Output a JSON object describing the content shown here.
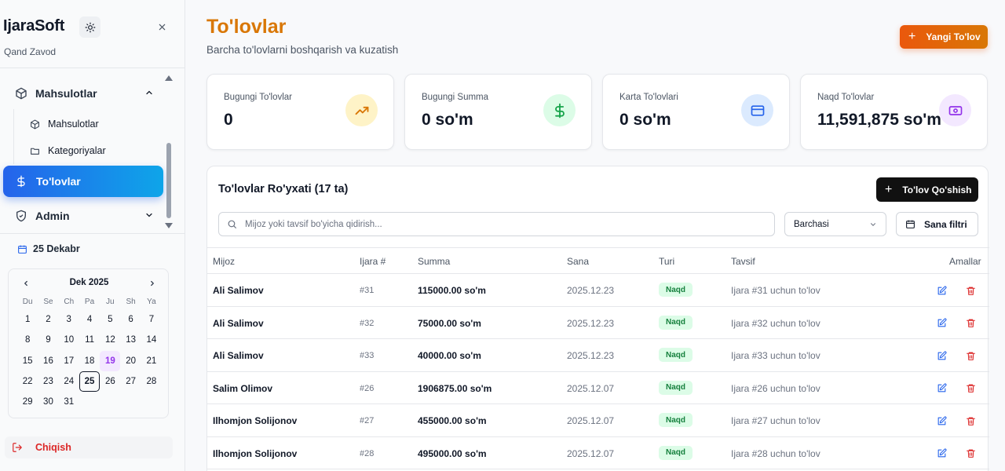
{
  "sidebar": {
    "brand": "IjaraSoft",
    "company": "Qand Zavod",
    "groups": {
      "products": {
        "label": "Mahsulotlar",
        "items": [
          "Mahsulotlar",
          "Kategoriyalar"
        ]
      },
      "payments": {
        "label": "To'lovlar"
      },
      "admin": {
        "label": "Admin"
      }
    },
    "current_date": "25 Dekabr",
    "calendar": {
      "title": "Dek 2025",
      "weekdays": [
        "Du",
        "Se",
        "Ch",
        "Pa",
        "Ju",
        "Sh",
        "Ya"
      ],
      "days": [
        1,
        2,
        3,
        4,
        5,
        6,
        7,
        8,
        9,
        10,
        11,
        12,
        13,
        14,
        15,
        16,
        17,
        18,
        19,
        20,
        21,
        22,
        23,
        24,
        25,
        26,
        27,
        28,
        29,
        30,
        31
      ],
      "highlighted_day": 19,
      "today": 25
    },
    "logout": "Chiqish"
  },
  "header": {
    "title": "To'lovlar",
    "subtitle": "Barcha to'lovlarni boshqarish va kuzatish",
    "new_button": "Yangi To'lov"
  },
  "stats": [
    {
      "label": "Bugungi To'lovlar",
      "value": "0",
      "icon": "trending-up-icon",
      "color": "#fef3c7",
      "icon_color": "#d97706"
    },
    {
      "label": "Bugungi Summa",
      "value": "0 so'm",
      "icon": "dollar-icon",
      "color": "#dcfce7",
      "icon_color": "#16a34a"
    },
    {
      "label": "Karta To'lovlari",
      "value": "0 so'm",
      "icon": "credit-card-icon",
      "color": "#dbeafe",
      "icon_color": "#2563eb"
    },
    {
      "label": "Naqd To'lovlar",
      "value": "11,591,875 so'm",
      "icon": "cash-icon",
      "color": "#f3e8ff",
      "icon_color": "#9333ea"
    }
  ],
  "list": {
    "title": "To'lovlar Ro'yxati (17 ta)",
    "add_button": "To'lov Qo'shish",
    "search_placeholder": "Mijoz yoki tavsif bo'yicha qidirish...",
    "filter_value": "Barchasi",
    "date_filter": "Sana filtri",
    "columns": {
      "client": "Mijoz",
      "ijara": "Ijara #",
      "sum": "Summa",
      "date": "Sana",
      "type": "Turi",
      "desc": "Tavsif",
      "actions": "Amallar"
    },
    "rows": [
      {
        "client": "Ali Salimov",
        "ijara": "#31",
        "sum": "115000.00 so'm",
        "date": "2025.12.23",
        "type": "Naqd",
        "desc": "Ijara #31 uchun to'lov"
      },
      {
        "client": "Ali Salimov",
        "ijara": "#32",
        "sum": "75000.00 so'm",
        "date": "2025.12.23",
        "type": "Naqd",
        "desc": "Ijara #32 uchun to'lov"
      },
      {
        "client": "Ali Salimov",
        "ijara": "#33",
        "sum": "40000.00 so'm",
        "date": "2025.12.23",
        "type": "Naqd",
        "desc": "Ijara #33 uchun to'lov"
      },
      {
        "client": "Salim Olimov",
        "ijara": "#26",
        "sum": "1906875.00 so'm",
        "date": "2025.12.07",
        "type": "Naqd",
        "desc": "Ijara #26 uchun to'lov"
      },
      {
        "client": "Ilhomjon Solijonov",
        "ijara": "#27",
        "sum": "455000.00 so'm",
        "date": "2025.12.07",
        "type": "Naqd",
        "desc": "Ijara #27 uchun to'lov"
      },
      {
        "client": "Ilhomjon Solijonov",
        "ijara": "#28",
        "sum": "495000.00 so'm",
        "date": "2025.12.07",
        "type": "Naqd",
        "desc": "Ijara #28 uchun to'lov"
      }
    ]
  }
}
